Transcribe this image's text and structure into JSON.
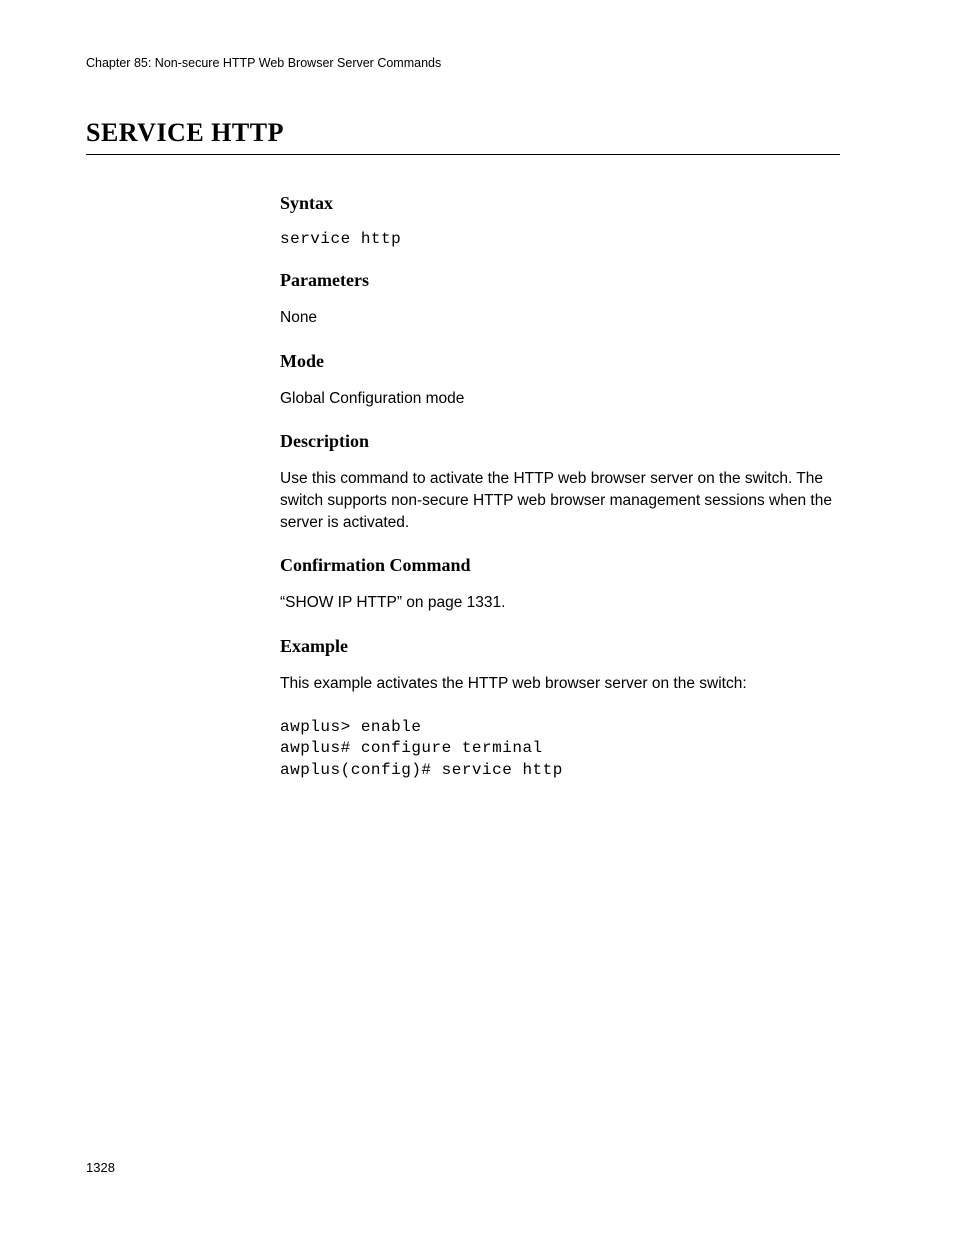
{
  "header": {
    "chapter_title": "Chapter 85: Non-secure HTTP Web Browser Server Commands"
  },
  "title": "SERVICE HTTP",
  "sections": {
    "syntax": {
      "heading": "Syntax",
      "command": "service http"
    },
    "parameters": {
      "heading": "Parameters",
      "text": "None"
    },
    "mode": {
      "heading": "Mode",
      "text": "Global Configuration mode"
    },
    "description": {
      "heading": "Description",
      "text": "Use this command to activate the HTTP web browser server on the switch. The switch supports non-secure HTTP web browser management sessions when the server is activated."
    },
    "confirmation": {
      "heading": "Confirmation Command",
      "text": "“SHOW IP HTTP” on page 1331."
    },
    "example": {
      "heading": "Example",
      "intro": "This example activates the HTTP web browser server on the switch:",
      "code": "awplus> enable\nawplus# configure terminal\nawplus(config)# service http"
    }
  },
  "page_number": "1328"
}
